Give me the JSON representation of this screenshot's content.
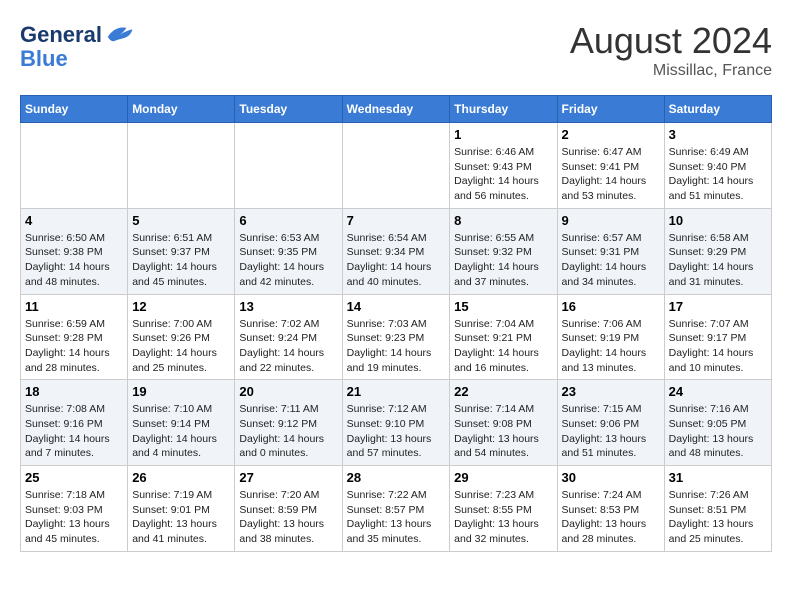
{
  "logo": {
    "line1": "General",
    "line2": "Blue"
  },
  "title": "August 2024",
  "location": "Missillac, France",
  "days_of_week": [
    "Sunday",
    "Monday",
    "Tuesday",
    "Wednesday",
    "Thursday",
    "Friday",
    "Saturday"
  ],
  "weeks": [
    [
      {
        "day": "",
        "info": ""
      },
      {
        "day": "",
        "info": ""
      },
      {
        "day": "",
        "info": ""
      },
      {
        "day": "",
        "info": ""
      },
      {
        "day": "1",
        "info": "Sunrise: 6:46 AM\nSunset: 9:43 PM\nDaylight: 14 hours\nand 56 minutes."
      },
      {
        "day": "2",
        "info": "Sunrise: 6:47 AM\nSunset: 9:41 PM\nDaylight: 14 hours\nand 53 minutes."
      },
      {
        "day": "3",
        "info": "Sunrise: 6:49 AM\nSunset: 9:40 PM\nDaylight: 14 hours\nand 51 minutes."
      }
    ],
    [
      {
        "day": "4",
        "info": "Sunrise: 6:50 AM\nSunset: 9:38 PM\nDaylight: 14 hours\nand 48 minutes."
      },
      {
        "day": "5",
        "info": "Sunrise: 6:51 AM\nSunset: 9:37 PM\nDaylight: 14 hours\nand 45 minutes."
      },
      {
        "day": "6",
        "info": "Sunrise: 6:53 AM\nSunset: 9:35 PM\nDaylight: 14 hours\nand 42 minutes."
      },
      {
        "day": "7",
        "info": "Sunrise: 6:54 AM\nSunset: 9:34 PM\nDaylight: 14 hours\nand 40 minutes."
      },
      {
        "day": "8",
        "info": "Sunrise: 6:55 AM\nSunset: 9:32 PM\nDaylight: 14 hours\nand 37 minutes."
      },
      {
        "day": "9",
        "info": "Sunrise: 6:57 AM\nSunset: 9:31 PM\nDaylight: 14 hours\nand 34 minutes."
      },
      {
        "day": "10",
        "info": "Sunrise: 6:58 AM\nSunset: 9:29 PM\nDaylight: 14 hours\nand 31 minutes."
      }
    ],
    [
      {
        "day": "11",
        "info": "Sunrise: 6:59 AM\nSunset: 9:28 PM\nDaylight: 14 hours\nand 28 minutes."
      },
      {
        "day": "12",
        "info": "Sunrise: 7:00 AM\nSunset: 9:26 PM\nDaylight: 14 hours\nand 25 minutes."
      },
      {
        "day": "13",
        "info": "Sunrise: 7:02 AM\nSunset: 9:24 PM\nDaylight: 14 hours\nand 22 minutes."
      },
      {
        "day": "14",
        "info": "Sunrise: 7:03 AM\nSunset: 9:23 PM\nDaylight: 14 hours\nand 19 minutes."
      },
      {
        "day": "15",
        "info": "Sunrise: 7:04 AM\nSunset: 9:21 PM\nDaylight: 14 hours\nand 16 minutes."
      },
      {
        "day": "16",
        "info": "Sunrise: 7:06 AM\nSunset: 9:19 PM\nDaylight: 14 hours\nand 13 minutes."
      },
      {
        "day": "17",
        "info": "Sunrise: 7:07 AM\nSunset: 9:17 PM\nDaylight: 14 hours\nand 10 minutes."
      }
    ],
    [
      {
        "day": "18",
        "info": "Sunrise: 7:08 AM\nSunset: 9:16 PM\nDaylight: 14 hours\nand 7 minutes."
      },
      {
        "day": "19",
        "info": "Sunrise: 7:10 AM\nSunset: 9:14 PM\nDaylight: 14 hours\nand 4 minutes."
      },
      {
        "day": "20",
        "info": "Sunrise: 7:11 AM\nSunset: 9:12 PM\nDaylight: 14 hours\nand 0 minutes."
      },
      {
        "day": "21",
        "info": "Sunrise: 7:12 AM\nSunset: 9:10 PM\nDaylight: 13 hours\nand 57 minutes."
      },
      {
        "day": "22",
        "info": "Sunrise: 7:14 AM\nSunset: 9:08 PM\nDaylight: 13 hours\nand 54 minutes."
      },
      {
        "day": "23",
        "info": "Sunrise: 7:15 AM\nSunset: 9:06 PM\nDaylight: 13 hours\nand 51 minutes."
      },
      {
        "day": "24",
        "info": "Sunrise: 7:16 AM\nSunset: 9:05 PM\nDaylight: 13 hours\nand 48 minutes."
      }
    ],
    [
      {
        "day": "25",
        "info": "Sunrise: 7:18 AM\nSunset: 9:03 PM\nDaylight: 13 hours\nand 45 minutes."
      },
      {
        "day": "26",
        "info": "Sunrise: 7:19 AM\nSunset: 9:01 PM\nDaylight: 13 hours\nand 41 minutes."
      },
      {
        "day": "27",
        "info": "Sunrise: 7:20 AM\nSunset: 8:59 PM\nDaylight: 13 hours\nand 38 minutes."
      },
      {
        "day": "28",
        "info": "Sunrise: 7:22 AM\nSunset: 8:57 PM\nDaylight: 13 hours\nand 35 minutes."
      },
      {
        "day": "29",
        "info": "Sunrise: 7:23 AM\nSunset: 8:55 PM\nDaylight: 13 hours\nand 32 minutes."
      },
      {
        "day": "30",
        "info": "Sunrise: 7:24 AM\nSunset: 8:53 PM\nDaylight: 13 hours\nand 28 minutes."
      },
      {
        "day": "31",
        "info": "Sunrise: 7:26 AM\nSunset: 8:51 PM\nDaylight: 13 hours\nand 25 minutes."
      }
    ]
  ]
}
